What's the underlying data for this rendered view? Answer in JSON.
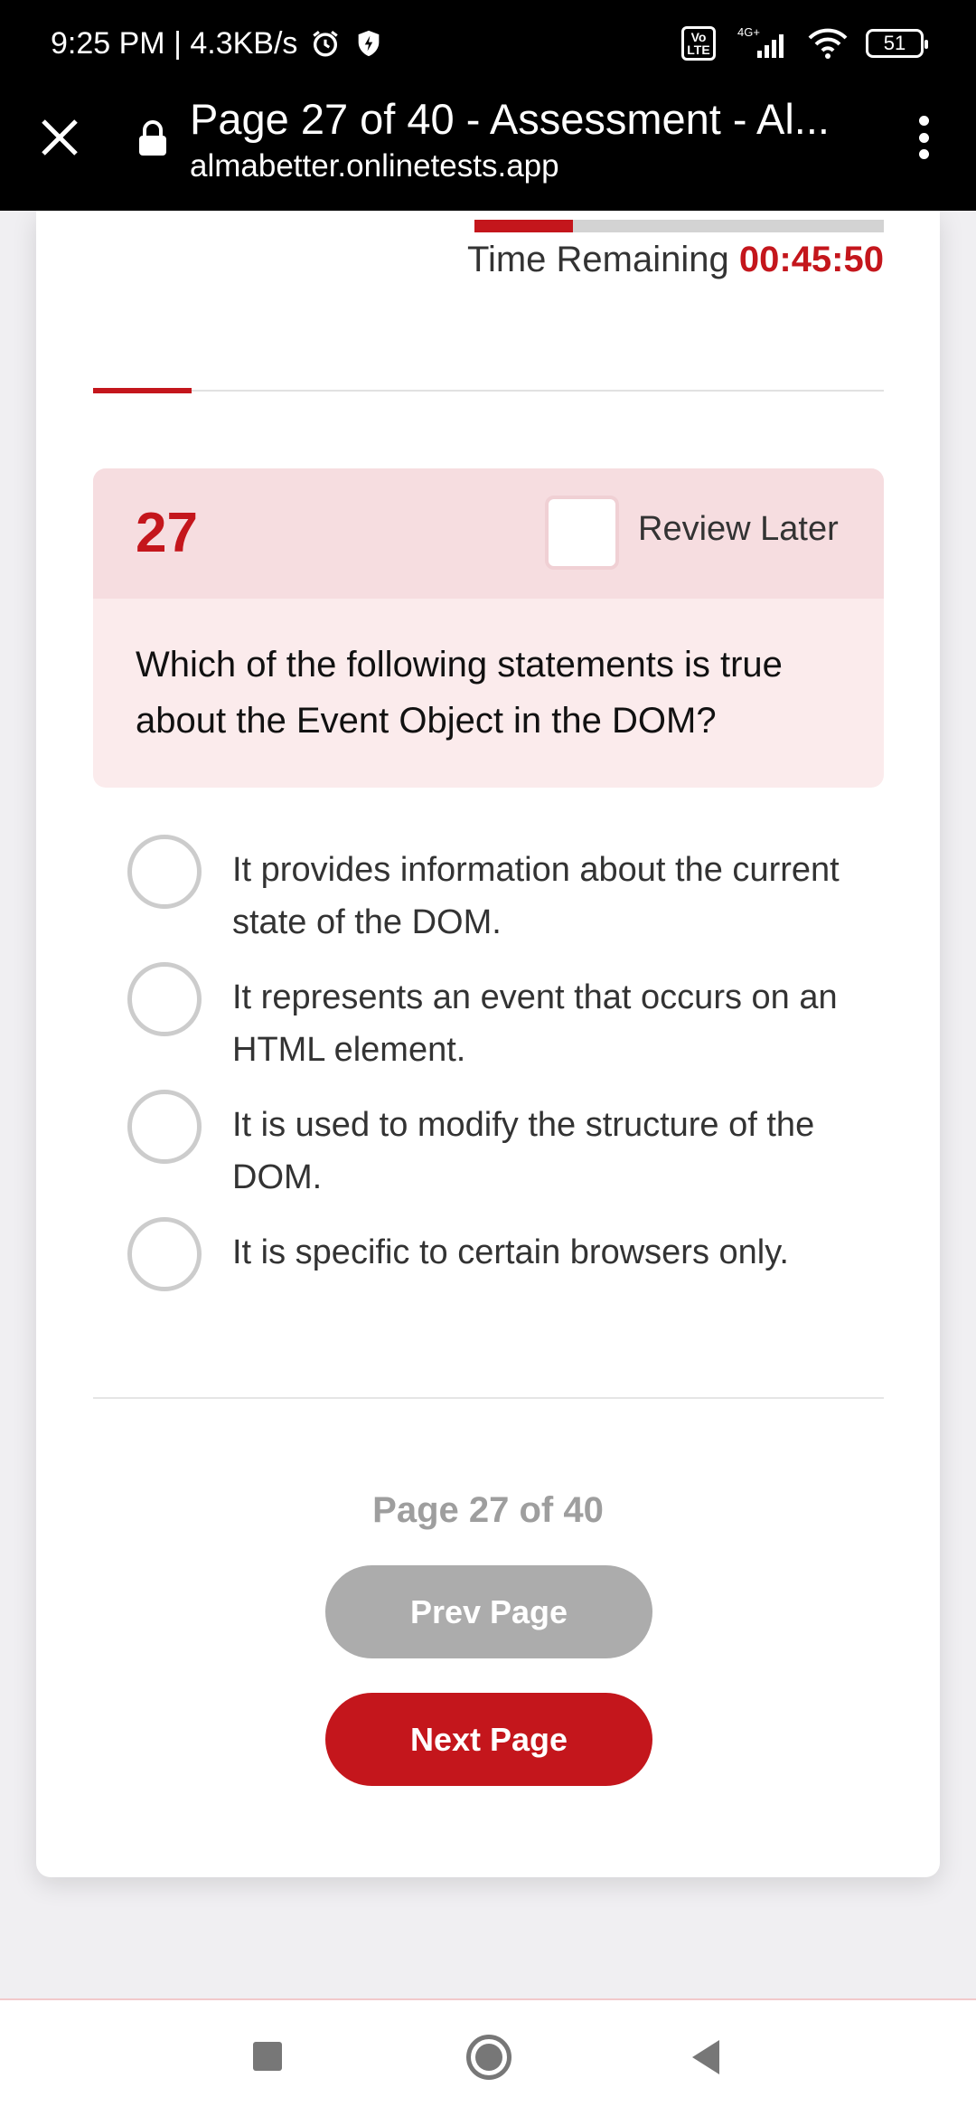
{
  "status_bar": {
    "time": "9:25 PM | 4.3KB/s",
    "network": "4G+",
    "volte": "Vo LTE",
    "battery": "51"
  },
  "browser": {
    "title": "Page 27 of 40 - Assessment - Al...",
    "url": "almabetter.onlinetests.app"
  },
  "timer": {
    "label": "Time Remaining",
    "value": "00:45:50",
    "elapsed_fraction": 0.24
  },
  "progress": {
    "fraction": 0.125
  },
  "question": {
    "number": "27",
    "review_label": "Review Later",
    "text": "Which of the following statements is true about the Event Object in the DOM?",
    "options": [
      "It provides information about the current state of the DOM.",
      "It represents an event that occurs on an HTML element.",
      "It is used to modify the structure of the DOM.",
      "It is specific to certain browsers only."
    ]
  },
  "pagination": {
    "label": "Page 27 of 40",
    "prev_label": "Prev Page",
    "next_label": "Next Page"
  },
  "colors": {
    "accent": "#c4161c",
    "disabled": "#acacac"
  }
}
